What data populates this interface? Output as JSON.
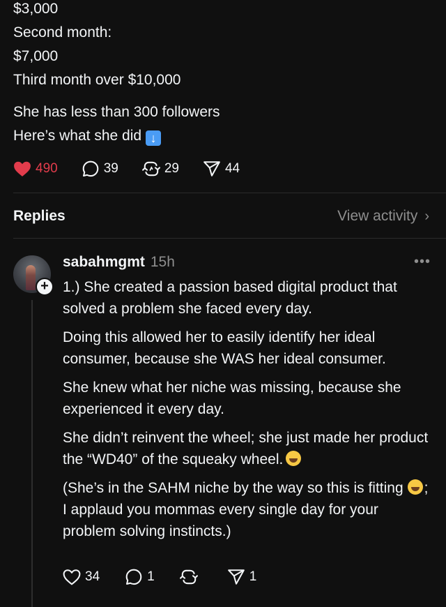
{
  "post": {
    "lines": [
      "$3,000",
      "Second month:",
      "$7,000",
      "Third month over $10,000",
      "She has less than 300 followers",
      "Here’s what she did"
    ],
    "actions": {
      "likes": "490",
      "comments": "39",
      "reposts": "29",
      "shares": "44"
    },
    "colors": {
      "like": "#e23c4c",
      "background": "#101010",
      "text": "#f3f5f7",
      "muted": "#8e8e8e"
    },
    "icons": [
      "heart-filled-icon",
      "comment-icon",
      "repost-icon",
      "share-icon",
      "down-arrow-emoji"
    ]
  },
  "replies_bar": {
    "title": "Replies",
    "view_activity": "View activity",
    "chevron": "›"
  },
  "reply": {
    "username": "sabahmgmt",
    "time": "15h",
    "more": "•••",
    "paragraphs": [
      "1.) She created a passion based digital product that solved a problem she faced every day.",
      "Doing this allowed her to easily identify her ideal consumer, because she WAS her ideal consumer.",
      "She knew what her niche was missing, because she experienced it every day.",
      "She didn’t reinvent the wheel; she just made her product the “WD40” of the squeaky wheel.",
      "(She’s in the SAHM niche by the way so this is fitting",
      "; I applaud you mommas every single day for your problem solving instincts.)"
    ],
    "actions": {
      "likes": "34",
      "comments": "1",
      "reposts": "",
      "shares": "1"
    }
  }
}
